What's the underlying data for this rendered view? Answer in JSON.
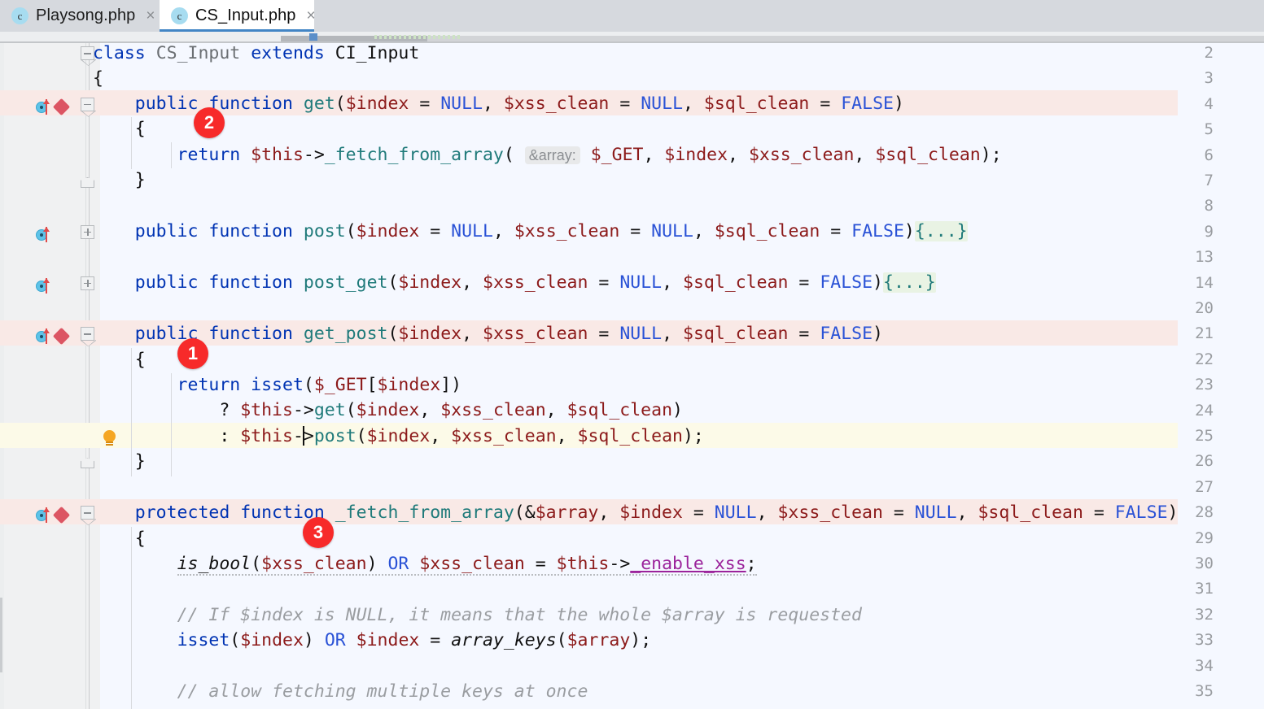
{
  "window": {
    "accent_color": "#4285c5",
    "editor_bg": "#f5f8ff",
    "gutter_bg": "#f0f1f2",
    "error_row_bg": "#f9e9e6",
    "caret_row_bg": "#fcfae8",
    "badge_color": "#f72a2a"
  },
  "tabs": [
    {
      "label": "Playsong.php",
      "icon": "php-class-icon",
      "icon_letter": "c",
      "close_label": "×",
      "active": false
    },
    {
      "label": "CS_Input.php",
      "icon": "php-class-icon",
      "icon_letter": "c",
      "close_label": "×",
      "active": true
    }
  ],
  "editor": {
    "language": "PHP",
    "caret_line": 25,
    "caret_column_hint": "between '-' and '>' of $this->post",
    "lines": [
      {
        "num": "2",
        "gutter": {
          "override": false,
          "bookmark": false
        },
        "fold": "minus"
      },
      {
        "num": "3",
        "gutter": {
          "override": false,
          "bookmark": false
        },
        "fold": "none"
      },
      {
        "num": "4",
        "gutter": {
          "override": true,
          "bookmark": true
        },
        "fold": "minus",
        "highlight": "error"
      },
      {
        "num": "5",
        "gutter": {
          "override": false,
          "bookmark": false
        },
        "fold": "none"
      },
      {
        "num": "6",
        "gutter": {
          "override": false,
          "bookmark": false
        },
        "fold": "none"
      },
      {
        "num": "7",
        "gutter": {
          "override": false,
          "bookmark": false
        },
        "fold": "end"
      },
      {
        "num": "8",
        "gutter": {
          "override": false,
          "bookmark": false
        },
        "fold": "none"
      },
      {
        "num": "9",
        "gutter": {
          "override": true,
          "bookmark": false
        },
        "fold": "plus"
      },
      {
        "num": "13",
        "gutter": {
          "override": false,
          "bookmark": false
        },
        "fold": "none"
      },
      {
        "num": "14",
        "gutter": {
          "override": true,
          "bookmark": false
        },
        "fold": "plus"
      },
      {
        "num": "20",
        "gutter": {
          "override": false,
          "bookmark": false
        },
        "fold": "none"
      },
      {
        "num": "21",
        "gutter": {
          "override": true,
          "bookmark": true
        },
        "fold": "minus",
        "highlight": "error"
      },
      {
        "num": "22",
        "gutter": {
          "override": false,
          "bookmark": false
        },
        "fold": "none"
      },
      {
        "num": "23",
        "gutter": {
          "override": false,
          "bookmark": false
        },
        "fold": "none"
      },
      {
        "num": "24",
        "gutter": {
          "override": false,
          "bookmark": false
        },
        "fold": "none"
      },
      {
        "num": "25",
        "gutter": {
          "override": false,
          "bookmark": false,
          "lightbulb": true
        },
        "fold": "none",
        "highlight": "caret"
      },
      {
        "num": "26",
        "gutter": {
          "override": false,
          "bookmark": false
        },
        "fold": "end"
      },
      {
        "num": "27",
        "gutter": {
          "override": false,
          "bookmark": false
        },
        "fold": "none"
      },
      {
        "num": "28",
        "gutter": {
          "override": true,
          "bookmark": true
        },
        "fold": "minus",
        "highlight": "error"
      },
      {
        "num": "29",
        "gutter": {
          "override": false,
          "bookmark": false
        },
        "fold": "none"
      },
      {
        "num": "30",
        "gutter": {
          "override": false,
          "bookmark": false
        },
        "fold": "none"
      },
      {
        "num": "31",
        "gutter": {
          "override": false,
          "bookmark": false
        },
        "fold": "none"
      },
      {
        "num": "32",
        "gutter": {
          "override": false,
          "bookmark": false
        },
        "fold": "none"
      },
      {
        "num": "33",
        "gutter": {
          "override": false,
          "bookmark": false
        },
        "fold": "none"
      },
      {
        "num": "34",
        "gutter": {
          "override": false,
          "bookmark": false
        },
        "fold": "none"
      },
      {
        "num": "35",
        "gutter": {
          "override": false,
          "bookmark": false
        },
        "fold": "none"
      }
    ],
    "source": {
      "l2": "class CS_Input extends CI_Input",
      "l3": "{",
      "l4": "    public function get($index = NULL, $xss_clean = NULL, $sql_clean = FALSE)",
      "l5": "    {",
      "l6": "        return $this->_fetch_from_array( &array: $_GET, $index, $xss_clean, $sql_clean);",
      "l7": "    }",
      "l8": "",
      "l9": "    public function post($index = NULL, $xss_clean = NULL, $sql_clean = FALSE){...}",
      "l13": "",
      "l14": "    public function post_get($index, $xss_clean = NULL, $sql_clean = FALSE){...}",
      "l20": "",
      "l21": "    public function get_post($index, $xss_clean = NULL, $sql_clean = FALSE)",
      "l22": "    {",
      "l23": "        return isset($_GET[$index])",
      "l24": "            ? $this->get($index, $xss_clean, $sql_clean)",
      "l25": "            : $this->post($index, $xss_clean, $sql_clean);",
      "l26": "    }",
      "l27": "",
      "l28": "    protected function _fetch_from_array(&$array, $index = NULL, $xss_clean = NULL, $sql_clean = FALSE)",
      "l29": "    {",
      "l30": "        is_bool($xss_clean) OR $xss_clean = $this->_enable_xss;",
      "l31": "",
      "l32": "        // If $index is NULL, it means that the whole $array is requested",
      "l33": "        isset($index) OR $index = array_keys($array);",
      "l34": "",
      "l35": "        // allow fetching multiple keys at once"
    },
    "inlay_hint": "&array:",
    "fold_placeholder": "{...}"
  },
  "annotations": [
    {
      "label": "1",
      "target_line": "21",
      "meaning": "step-1-badge"
    },
    {
      "label": "2",
      "target_line": "4",
      "meaning": "step-2-badge"
    },
    {
      "label": "3",
      "target_line": "28",
      "meaning": "step-3-badge"
    }
  ]
}
